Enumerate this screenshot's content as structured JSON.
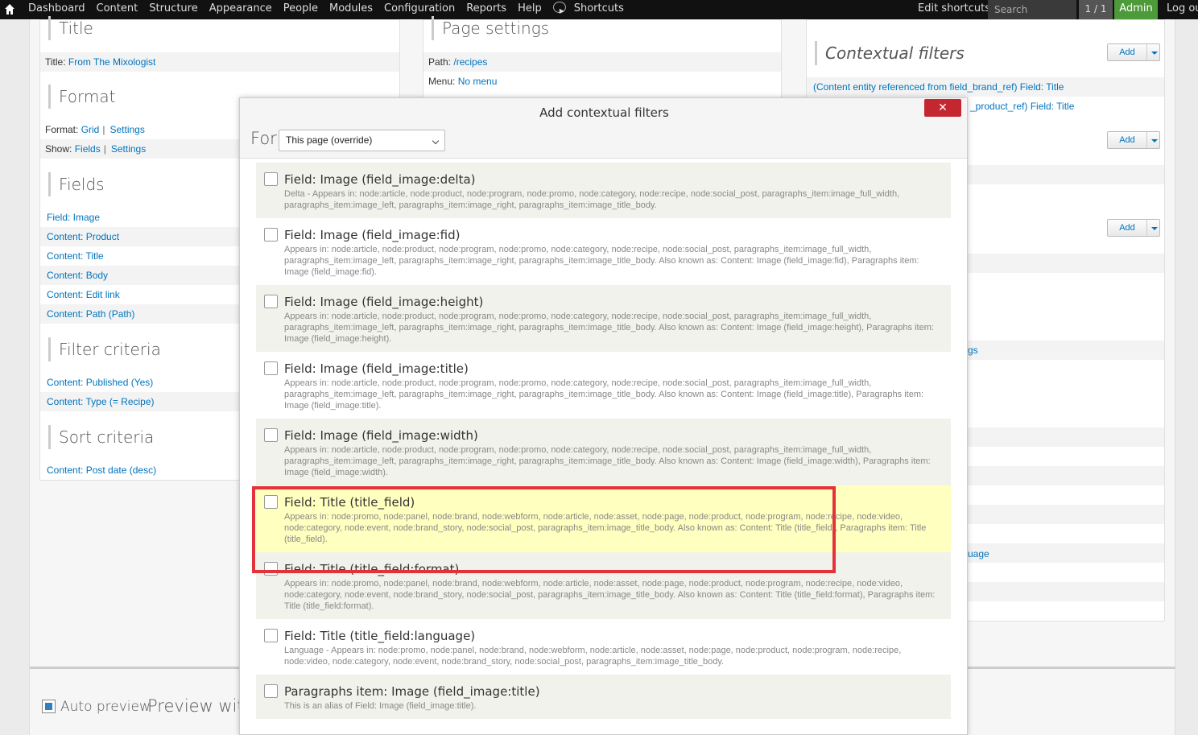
{
  "toolbar": {
    "nav": [
      "Dashboard",
      "Content",
      "Structure",
      "Appearance",
      "People",
      "Modules",
      "Configuration",
      "Reports",
      "Help"
    ],
    "shortcuts": "Shortcuts",
    "edit_shortcuts": "Edit shortcuts",
    "search_placeholder": "Search",
    "pager": "1 / 1",
    "user": "Admin",
    "logout": "Log out"
  },
  "left": {
    "title_section": "Title",
    "title_key": "Title:",
    "title_value": "From The Mixologist",
    "format_section": "Format",
    "format_key": "Format:",
    "format_value": "Grid",
    "format_settings": "Settings",
    "show_key": "Show:",
    "show_value": "Fields",
    "show_settings": "Settings",
    "fields_section": "Fields",
    "fields": [
      "Field: Image",
      "Content: Product",
      "Content: Title",
      "Content: Body",
      "Content: Edit link",
      "Content: Path (Path)"
    ],
    "filter_section": "Filter criteria",
    "filters": [
      "Content: Published (Yes)",
      "Content: Type (= Recipe)"
    ],
    "sort_section": "Sort criteria",
    "sorts": [
      "Content: Post date (desc)"
    ]
  },
  "middle": {
    "page_settings": "Page settings",
    "path_key": "Path:",
    "path_value": "/recipes",
    "menu_key": "Menu:",
    "menu_value": "No menu"
  },
  "right": {
    "contextual_filters": "Contextual filters",
    "add": "Add",
    "cf1": "(Content entity referenced from field_brand_ref) Field: Title",
    "cf2": "_product_ref) Field: Title",
    "partial1": "gs",
    "partial2": "uage"
  },
  "bottom": {
    "auto_preview": "Auto preview",
    "preview_with": "Preview with"
  },
  "dialog": {
    "title": "Add contextual filters",
    "close": "✕",
    "for_label": "For",
    "for_value": "This page (override)",
    "items": [
      {
        "name": "Field: Image (field_image:delta)",
        "desc": "Delta - Appears in: node:article, node:product, node:program, node:promo, node:category, node:recipe, node:social_post, paragraphs_item:image_full_width, paragraphs_item:image_left, paragraphs_item:image_right, paragraphs_item:image_title_body."
      },
      {
        "name": "Field: Image (field_image:fid)",
        "desc": "Appears in: node:article, node:product, node:program, node:promo, node:category, node:recipe, node:social_post, paragraphs_item:image_full_width, paragraphs_item:image_left, paragraphs_item:image_right, paragraphs_item:image_title_body. Also known as: Content: Image (field_image:fid), Paragraphs item: Image (field_image:fid)."
      },
      {
        "name": "Field: Image (field_image:height)",
        "desc": "Appears in: node:article, node:product, node:program, node:promo, node:category, node:recipe, node:social_post, paragraphs_item:image_full_width, paragraphs_item:image_left, paragraphs_item:image_right, paragraphs_item:image_title_body. Also known as: Content: Image (field_image:height), Paragraphs item: Image (field_image:height)."
      },
      {
        "name": "Field: Image (field_image:title)",
        "desc": "Appears in: node:article, node:product, node:program, node:promo, node:category, node:recipe, node:social_post, paragraphs_item:image_full_width, paragraphs_item:image_left, paragraphs_item:image_right, paragraphs_item:image_title_body. Also known as: Content: Image (field_image:title), Paragraphs item: Image (field_image:title)."
      },
      {
        "name": "Field: Image (field_image:width)",
        "desc": "Appears in: node:article, node:product, node:program, node:promo, node:category, node:recipe, node:social_post, paragraphs_item:image_full_width, paragraphs_item:image_left, paragraphs_item:image_right, paragraphs_item:image_title_body. Also known as: Content: Image (field_image:width), Paragraphs item: Image (field_image:width)."
      },
      {
        "name": "Field: Title (title_field)",
        "desc": "Appears in: node:promo, node:panel, node:brand, node:webform, node:article, node:asset, node:page, node:product, node:program, node:recipe, node:video, node:category, node:event, node:brand_story, node:social_post, paragraphs_item:image_title_body. Also known as: Content: Title (title_field), Paragraphs item: Title (title_field)."
      },
      {
        "name": "Field: Title (title_field:format)",
        "desc": "Appears in: node:promo, node:panel, node:brand, node:webform, node:article, node:asset, node:page, node:product, node:program, node:recipe, node:video, node:category, node:event, node:brand_story, node:social_post, paragraphs_item:image_title_body. Also known as: Content: Title (title_field:format), Paragraphs item: Title (title_field:format)."
      },
      {
        "name": "Field: Title (title_field:language)",
        "desc": "Language - Appears in: node:promo, node:panel, node:brand, node:webform, node:article, node:asset, node:page, node:product, node:program, node:recipe, node:video, node:category, node:event, node:brand_story, node:social_post, paragraphs_item:image_title_body."
      },
      {
        "name": "Paragraphs item: Image (field_image:title)",
        "desc": "This is an alias of Field: Image (field_image:title)."
      }
    ]
  }
}
